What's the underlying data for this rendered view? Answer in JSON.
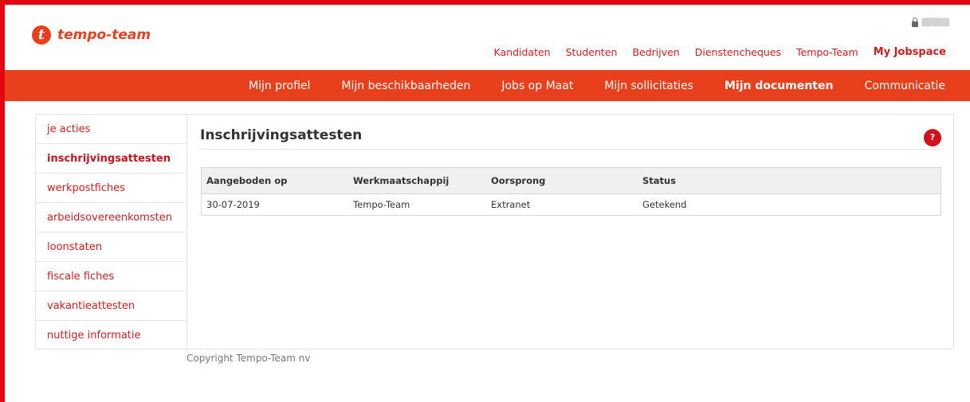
{
  "brand": {
    "name": "tempo-team",
    "logo_letter": "t",
    "color": "#e8401c"
  },
  "login": {
    "username_hint": ""
  },
  "top_nav": {
    "items": [
      {
        "label": "Kandidaten"
      },
      {
        "label": "Studenten"
      },
      {
        "label": "Bedrijven"
      },
      {
        "label": "Dienstencheques"
      },
      {
        "label": "Tempo-Team"
      },
      {
        "label": "My Jobspace",
        "active": true
      }
    ]
  },
  "main_nav": {
    "items": [
      {
        "label": "Mijn profiel"
      },
      {
        "label": "Mijn beschikbaarheden"
      },
      {
        "label": "Jobs op Maat"
      },
      {
        "label": "Mijn sollicitaties"
      },
      {
        "label": "Mijn documenten",
        "active": true
      },
      {
        "label": "Communicatie"
      }
    ]
  },
  "sidebar": {
    "items": [
      {
        "label": "je acties"
      },
      {
        "label": "inschrijvingsattesten",
        "active": true
      },
      {
        "label": "werkpostfiches"
      },
      {
        "label": "arbeidsovereenkomsten"
      },
      {
        "label": "loonstaten"
      },
      {
        "label": "fiscale fiches"
      },
      {
        "label": "vakantieattesten"
      },
      {
        "label": "nuttige informatie"
      }
    ]
  },
  "main": {
    "title": "Inschrijvingsattesten",
    "help_icon": "?",
    "table": {
      "headers": [
        "Aangeboden op",
        "Werkmaatschappij",
        "Oorsprong",
        "Status"
      ],
      "rows": [
        [
          "30-07-2019",
          "Tempo-Team",
          "Extranet",
          "Getekend"
        ]
      ]
    }
  },
  "footer": {
    "copyright": "Copyright Tempo-Team nv"
  },
  "colors": {
    "accent_red": "#e30613",
    "nav_orange": "#e8401c",
    "link_red": "#d21d1d"
  }
}
